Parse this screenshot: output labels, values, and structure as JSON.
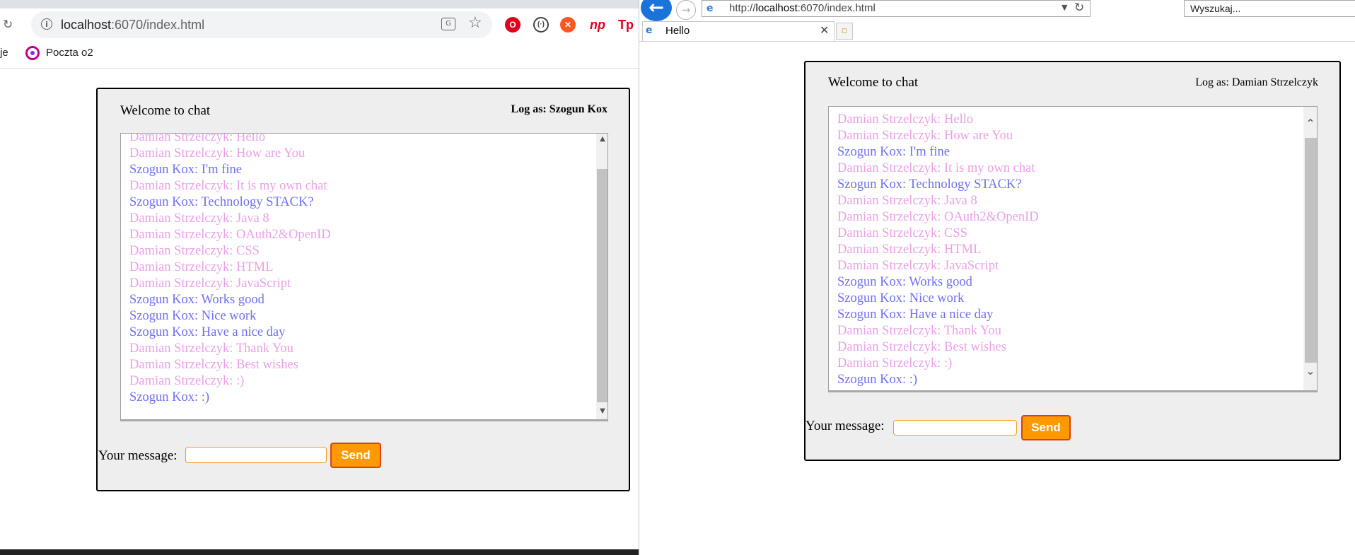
{
  "left_browser": {
    "url_host": "localhost",
    "url_rest": ":6070/index.html",
    "bookmark_partial": "je",
    "bookmark_label": "Poczta o2",
    "extensions": [
      "np",
      "Tp"
    ]
  },
  "left_chat": {
    "welcome": "Welcome to chat",
    "log_as": "Log as: Szogun Kox",
    "your_message_label": "Your message:",
    "send_label": "Send",
    "input_value": ""
  },
  "right_browser": {
    "address_prefix": "http://",
    "address_host": "localhost",
    "address_rest": ":6070/index.html",
    "search_placeholder": "Wyszukaj...",
    "tab_title": "Hello"
  },
  "right_chat": {
    "welcome": "Welcome to chat",
    "log_as": "Log as: Damian Strzelczyk",
    "your_message_label": "Your message:",
    "send_label": "Send",
    "input_value": ""
  },
  "messages": [
    {
      "author": "damian",
      "text": "Damian Strzelczyk: Hello"
    },
    {
      "author": "damian",
      "text": "Damian Strzelczyk: How are You"
    },
    {
      "author": "szogun",
      "text": "Szogun Kox: I'm fine"
    },
    {
      "author": "damian",
      "text": "Damian Strzelczyk: It is my own chat"
    },
    {
      "author": "szogun",
      "text": "Szogun Kox: Technology STACK?"
    },
    {
      "author": "damian",
      "text": "Damian Strzelczyk: Java 8"
    },
    {
      "author": "damian",
      "text": "Damian Strzelczyk: OAuth2&OpenID"
    },
    {
      "author": "damian",
      "text": "Damian Strzelczyk: CSS"
    },
    {
      "author": "damian",
      "text": "Damian Strzelczyk: HTML"
    },
    {
      "author": "damian",
      "text": "Damian Strzelczyk: JavaScript"
    },
    {
      "author": "szogun",
      "text": "Szogun Kox: Works good"
    },
    {
      "author": "szogun",
      "text": "Szogun Kox: Nice work"
    },
    {
      "author": "szogun",
      "text": "Szogun Kox: Have a nice day"
    },
    {
      "author": "damian",
      "text": "Damian Strzelczyk: Thank You"
    },
    {
      "author": "damian",
      "text": "Damian Strzelczyk: Best wishes"
    },
    {
      "author": "damian",
      "text": "Damian Strzelczyk: :)"
    },
    {
      "author": "szogun",
      "text": "Szogun Kox: :)"
    }
  ],
  "colors": {
    "damian": "#eaa0e6",
    "szogun": "#6e6ff0",
    "send_button": "#ff9900",
    "send_border": "#d84315",
    "input_border": "#f79a1f",
    "panel_bg": "#eeeeee"
  }
}
